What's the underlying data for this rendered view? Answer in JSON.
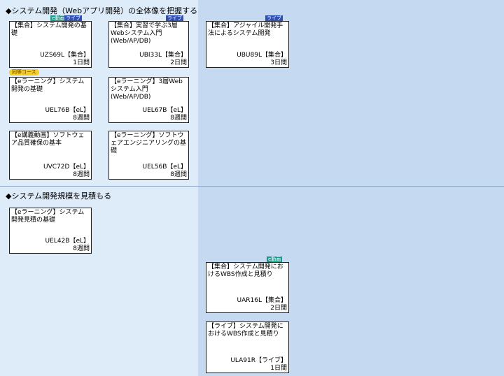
{
  "sections": [
    {
      "title": "◆システム開発（Webアプリ開発）の全体像を把握する"
    },
    {
      "title": "◆システム開発規模を見積もる"
    }
  ],
  "badges": {
    "live": "ライブ",
    "video": "e動画",
    "same_course": "同等コース"
  },
  "cards": [
    {
      "title": "【集合】システム開発の基礎",
      "code": "UZS69L【集合】",
      "duration": "1日間"
    },
    {
      "title": "【集合】実習で学ぶ3層Webシステム入門(Web/AP/DB)",
      "code": "UBI33L【集合】",
      "duration": "2日間"
    },
    {
      "title": "【集合】アジャイル開発手法によるシステム開発",
      "code": "UBU89L【集合】",
      "duration": "3日間"
    },
    {
      "title": "【eラーニング】システム開発の基礎",
      "code": "UEL76B【eL】",
      "duration": "8週間"
    },
    {
      "title": "【eラーニング】3層Webシステム入門(Web/AP/DB)",
      "code": "UEL67B【eL】",
      "duration": "8週間"
    },
    {
      "title": "【e講義動画】ソフトウェア品質確保の基本",
      "code": "UVC72D【eL】",
      "duration": "8週間"
    },
    {
      "title": "【eラーニング】ソフトウェアエンジニアリングの基礎",
      "code": "UEL56B【eL】",
      "duration": "8週間"
    },
    {
      "title": "【eラーニング】システム開発見積の基礎",
      "code": "UEL42B【eL】",
      "duration": "8週間"
    },
    {
      "title": "【集合】システム開発におけるWBS作成と見積り",
      "code": "UAR16L【集合】",
      "duration": "2日間"
    },
    {
      "title": "【ライブ】システム開発におけるWBS作成と見積り",
      "code": "ULA91R【ライブ】",
      "duration": "1日間"
    }
  ]
}
